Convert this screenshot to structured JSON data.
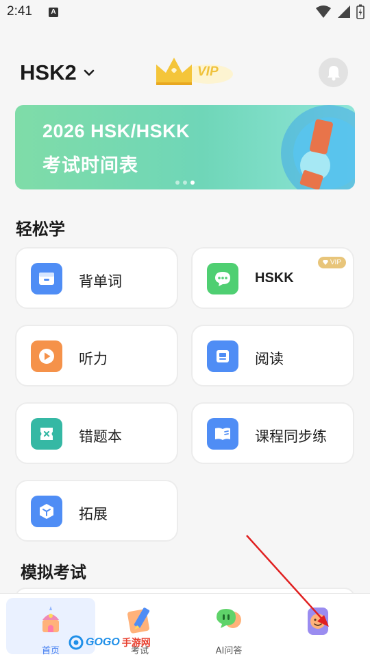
{
  "status_bar": {
    "time": "2:41",
    "a_badge": "A"
  },
  "header": {
    "level": "HSK2",
    "vip_label": "VIP"
  },
  "banner": {
    "line1": "2026 HSK/HSKK",
    "line2": "考试时间表"
  },
  "section_easy": {
    "title": "轻松学"
  },
  "cards": [
    {
      "label": "背单词",
      "icon": "flashcard-box-icon",
      "color": "#4f8df5"
    },
    {
      "label": "HSKK",
      "icon": "chat-bubble-icon",
      "color": "#4fcf72",
      "vip": "VIP"
    },
    {
      "label": "听力",
      "icon": "play-icon",
      "color": "#f5924a"
    },
    {
      "label": "阅读",
      "icon": "reader-icon",
      "color": "#4f8df5"
    },
    {
      "label": "错题本",
      "icon": "wrong-book-icon",
      "color": "#35b8a4"
    },
    {
      "label": "课程同步练",
      "icon": "open-book-icon",
      "color": "#4f8df5"
    },
    {
      "label": "拓展",
      "icon": "cube-icon",
      "color": "#4f8df5"
    }
  ],
  "section_mock": {
    "title": "模拟考试"
  },
  "tabs": [
    {
      "label": "首页",
      "icon": "home-castle-icon"
    },
    {
      "label": "考试",
      "icon": "pencil-icon"
    },
    {
      "label": "AI问答",
      "icon": "ai-chat-icon"
    },
    {
      "label": "",
      "icon": "profile-avatar-icon"
    }
  ],
  "watermark": {
    "text": "GOGO",
    "sub": "手游网"
  }
}
